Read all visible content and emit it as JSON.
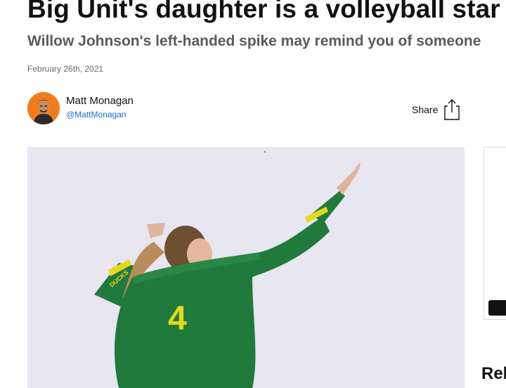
{
  "article": {
    "headline": "Big Unit's daughter is a volleyball star",
    "subheadline": "Willow Johnson's left-handed spike may remind you of someone",
    "date": "February 26th, 2021"
  },
  "author": {
    "name": "Matt Monagan",
    "handle": "@MattMonagan"
  },
  "share": {
    "label": "Share",
    "icon": "share-icon"
  },
  "hero": {
    "jersey_number": "4",
    "sleeve_text": "DUCKS",
    "colors": {
      "background": "#e7e6f1",
      "jersey": "#1f7a3b",
      "trim": "#e8d81a"
    }
  },
  "sidebar": {
    "related_heading": "Rel"
  },
  "colors": {
    "link": "#1a6fd6",
    "avatar_bg": "#f27b1b",
    "subhead": "#5a5a5a"
  }
}
